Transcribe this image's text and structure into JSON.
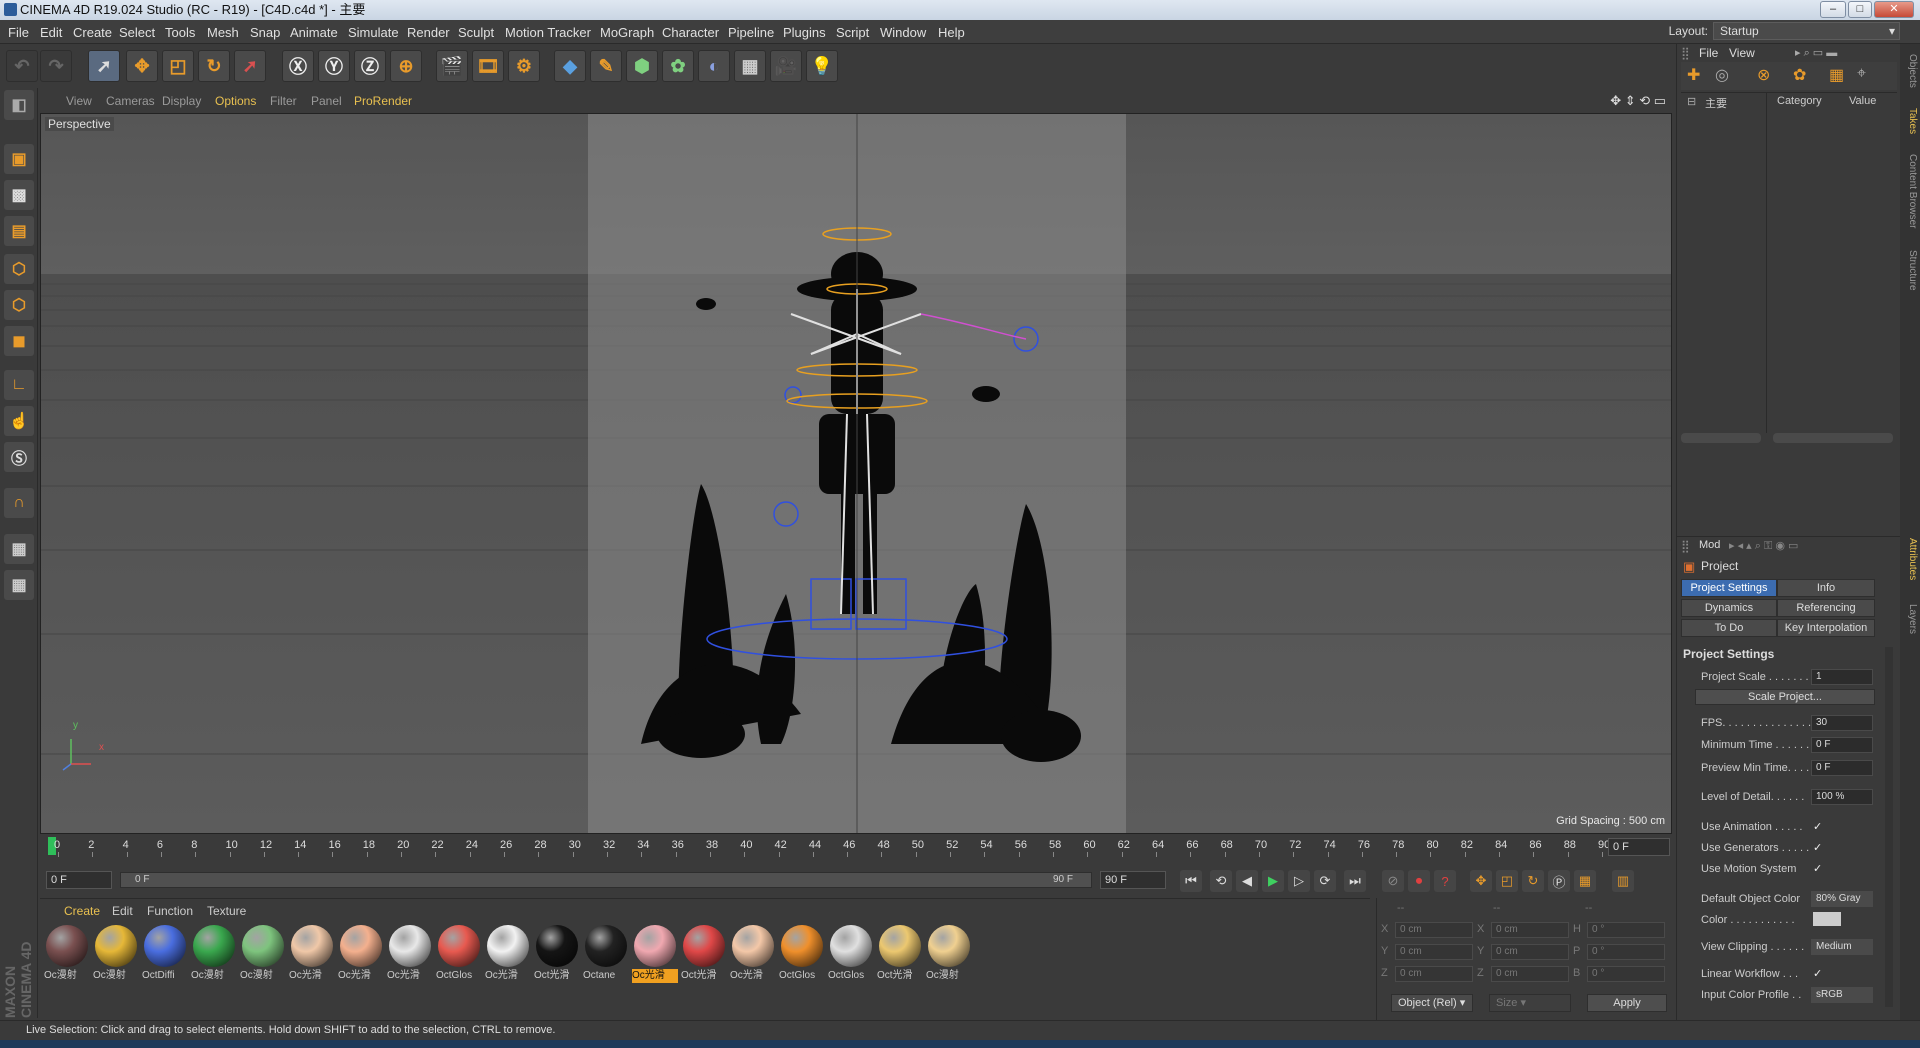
{
  "window": {
    "title": "CINEMA 4D R19.024 Studio (RC - R19) - [C4D.c4d *] - 主要"
  },
  "menubar": {
    "items": [
      "File",
      "Edit",
      "Create",
      "Select",
      "Tools",
      "Mesh",
      "Snap",
      "Animate",
      "Simulate",
      "Render",
      "Sculpt",
      "Motion Tracker",
      "MoGraph",
      "Character",
      "Pipeline",
      "Plugins",
      "Script",
      "Window",
      "Help"
    ],
    "layout_label": "Layout:",
    "layout_value": "Startup"
  },
  "viewport": {
    "menu": [
      "View",
      "Cameras",
      "Display",
      "Options",
      "Filter",
      "Panel",
      "ProRender"
    ],
    "active_menu": "Options",
    "camera_label": "Perspective",
    "grid_spacing": "Grid Spacing : 500 cm",
    "axis_y": "y",
    "axis_x": "x"
  },
  "timeline": {
    "ticks": [
      "0",
      "2",
      "4",
      "6",
      "8",
      "10",
      "12",
      "14",
      "16",
      "18",
      "20",
      "22",
      "24",
      "26",
      "28",
      "30",
      "32",
      "34",
      "36",
      "38",
      "40",
      "42",
      "44",
      "46",
      "48",
      "50",
      "52",
      "54",
      "56",
      "58",
      "60",
      "62",
      "64",
      "66",
      "68",
      "70",
      "72",
      "74",
      "76",
      "78",
      "80",
      "82",
      "84",
      "86",
      "88",
      "90"
    ],
    "current_frame": "0 F",
    "start_field": "0 F",
    "range_start": "0 F",
    "range_end": "90 F",
    "end_field": "90 F"
  },
  "materials": {
    "menu": [
      "Create",
      "Edit",
      "Function",
      "Texture"
    ],
    "items": [
      {
        "name": "Oc漫射",
        "color": "#7a5050"
      },
      {
        "name": "Oc漫射",
        "color": "#e6b838"
      },
      {
        "name": "OctDiffi",
        "color": "#4a6ee0"
      },
      {
        "name": "Oc漫射",
        "color": "#3aa84e"
      },
      {
        "name": "Oc漫射",
        "color": "#7ec47e"
      },
      {
        "name": "Oc光滑",
        "color": "#f0c8a8"
      },
      {
        "name": "Oc光滑",
        "color": "#f4b08e"
      },
      {
        "name": "Oc光滑",
        "color": "#e8e8e8"
      },
      {
        "name": "OctGlos",
        "color": "#e85a50"
      },
      {
        "name": "Oc光滑",
        "color": "#f2f2f2"
      },
      {
        "name": "Oct光滑",
        "color": "#151515"
      },
      {
        "name": "Octane",
        "color": "#222222"
      },
      {
        "name": "Oc光滑",
        "color": "#f0a8b0"
      },
      {
        "name": "Oct光滑",
        "color": "#e04848"
      },
      {
        "name": "Oc光滑",
        "color": "#f4c8a8"
      },
      {
        "name": "OctGlos",
        "color": "#f0902c"
      },
      {
        "name": "OctGlos",
        "color": "#e0e0e0"
      },
      {
        "name": "Oct光滑",
        "color": "#ecc870"
      },
      {
        "name": "Oc漫射",
        "color": "#f0d090"
      }
    ],
    "selected_index": 12
  },
  "coordinates": {
    "headers": [
      "--",
      "--",
      "--"
    ],
    "rows": [
      {
        "l1": "X",
        "v1": "0 cm",
        "l2": "X",
        "v2": "0 cm",
        "l3": "H",
        "v3": "0 °"
      },
      {
        "l1": "Y",
        "v1": "0 cm",
        "l2": "Y",
        "v2": "0 cm",
        "l3": "P",
        "v3": "0 °"
      },
      {
        "l1": "Z",
        "v1": "0 cm",
        "l2": "Z",
        "v2": "0 cm",
        "l3": "B",
        "v3": "0 °"
      }
    ],
    "mode": "Object (Rel)",
    "size": "Size",
    "apply": "Apply"
  },
  "status": {
    "text": "Live Selection: Click and drag to select elements. Hold down SHIFT to add to the selection, CTRL to remove."
  },
  "objects_panel": {
    "menu": [
      "File",
      "View"
    ],
    "root": "主要",
    "col_category": "Category",
    "col_value": "Value"
  },
  "attributes": {
    "menu": "Mod",
    "object": "Project",
    "tabs": [
      {
        "label": "Project Settings",
        "active": true
      },
      {
        "label": "Info",
        "active": false
      },
      {
        "label": "Dynamics",
        "active": false
      },
      {
        "label": "Referencing",
        "active": false
      },
      {
        "label": "To Do",
        "active": false
      },
      {
        "label": "Key Interpolation",
        "active": false
      }
    ],
    "section": "Project Settings",
    "project_scale_label": "Project Scale . . . . . . .",
    "project_scale": "1",
    "scale_project_button": "Scale Project...",
    "fps_label": "FPS. . . . . . . . . . . . . . .",
    "fps": "30",
    "min_time_label": "Minimum Time . . . . . .",
    "min_time": "0 F",
    "preview_min_label": "Preview Min Time. . . .",
    "preview_min": "0 F",
    "lod_label": "Level of Detail. . . . . .",
    "lod": "100 %",
    "use_animation_label": "Use Animation . . . . .",
    "use_generators_label": "Use Generators . . . . .",
    "use_motion_label": "Use Motion System",
    "check": "✓",
    "default_color_label": "Default Object Color",
    "default_color": "80% Gray",
    "color_label": "Color . . . . . . . . . . .",
    "view_clipping_label": "View Clipping . . . . . .",
    "view_clipping": "Medium",
    "linear_workflow_label": "Linear Workflow . . .",
    "input_profile_label": "Input Color Profile . .",
    "input_profile": "sRGB"
  },
  "side_tabs": [
    "Objects",
    "Takes",
    "Content Browser",
    "Structure",
    "Attributes",
    "Layers"
  ],
  "brand": "MAXON CINEMA 4D",
  "colors": {
    "accent": "#3c6cb0",
    "highlight": "#f0a020",
    "viewport_bg": "#5e5e5e"
  }
}
